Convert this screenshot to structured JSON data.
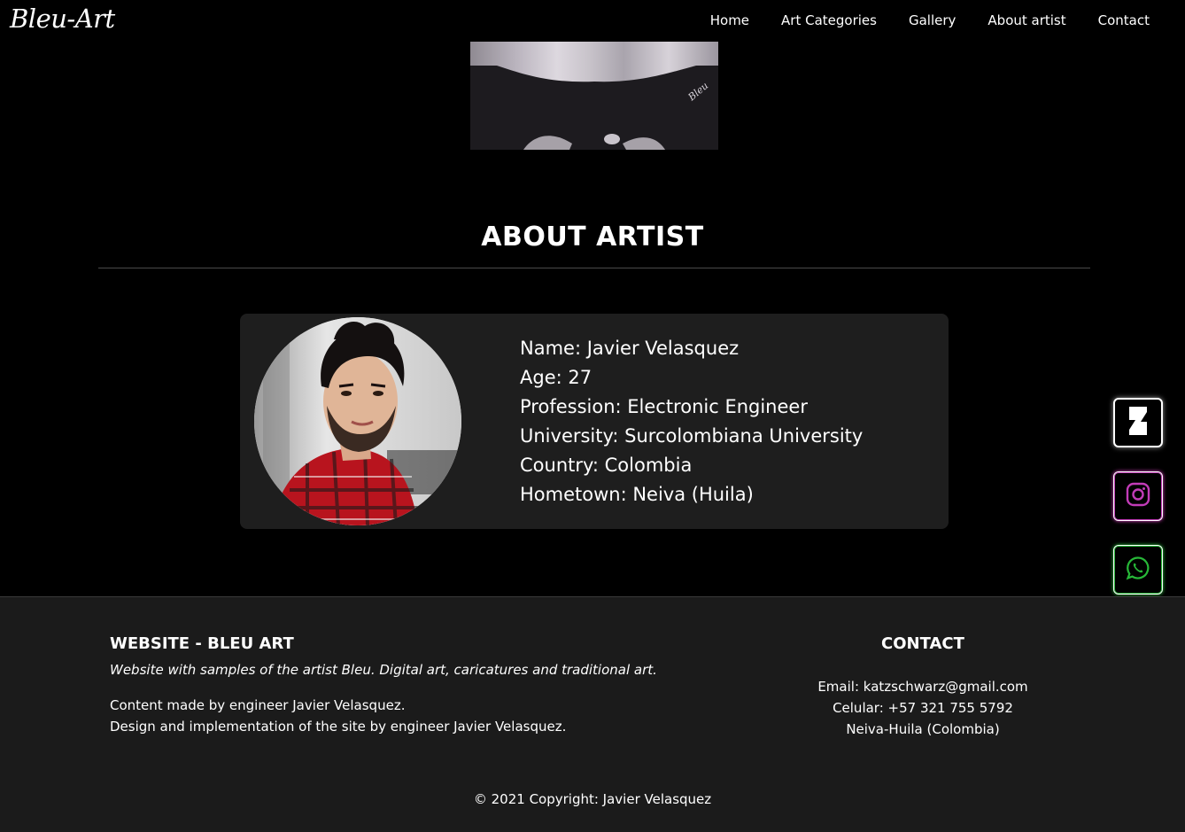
{
  "navbar": {
    "brand": "Bleu-Art",
    "links": [
      "Home",
      "Art Categories",
      "Gallery",
      "About artist",
      "Contact"
    ]
  },
  "about": {
    "title": "ABOUT ARTIST",
    "details": [
      "Name: Javier Velasquez",
      "Age: 27",
      "Profession: Electronic Engineer",
      "University: Surcolombiana University",
      "Country: Colombia",
      "Hometown: Neiva (Huila)"
    ]
  },
  "social": {
    "icons": [
      "deviantart-icon",
      "instagram-icon",
      "whatsapp-icon"
    ],
    "colors": {
      "instagram": "#c23cb8",
      "whatsapp": "#27b838"
    }
  },
  "footer": {
    "heading": "WEBSITE - BLEU ART",
    "description": "Website with samples of the artist Bleu. Digital art, caricatures and traditional art.",
    "credits": [
      "Content made by engineer Javier Velasquez.",
      "Design and implementation of the site by engineer Javier Velasquez."
    ],
    "contact_heading": "CONTACT",
    "contact": [
      "Email: katzschwarz@gmail.com",
      "Celular: +57 321 755 5792",
      "Neiva-Huila (Colombia)"
    ],
    "copyright": "© 2021 Copyright: Javier Velasquez"
  }
}
